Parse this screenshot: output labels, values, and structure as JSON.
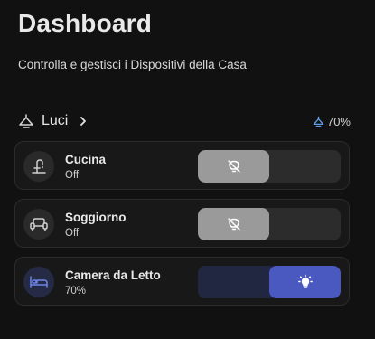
{
  "page": {
    "title": "Dashboard",
    "subtitle": "Controlla e gestisci i Dispositivi della Casa"
  },
  "section": {
    "title": "Luci",
    "percent": "70%",
    "icon": "ceiling-light-icon"
  },
  "colors": {
    "background": "#111111",
    "card": "#181818",
    "accent": "#4a59c0",
    "accent_track": "#222741",
    "off_knob": "#9a9a9a",
    "pct_icon": "#5fa0e8"
  },
  "devices": [
    {
      "name": "Cucina",
      "state": "Off",
      "icon": "kitchen-faucet-icon",
      "on": false
    },
    {
      "name": "Soggiorno",
      "state": "Off",
      "icon": "sofa-icon",
      "on": false
    },
    {
      "name": "Camera da Letto",
      "state": "70%",
      "icon": "bed-icon",
      "on": true,
      "level": 0.7
    }
  ]
}
